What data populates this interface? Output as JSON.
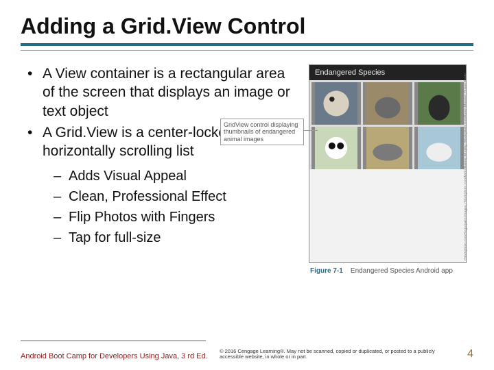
{
  "title": "Adding a Grid.View Control",
  "bullets": {
    "b1": "A View container is a rectangular area of the screen that displays an  image or text object",
    "b2": "A Grid.View is a center-locked horizontally scrolling list",
    "sub1": "Adds Visual Appeal",
    "sub2": "Clean, Professional Effect",
    "sub3": "Flip Photos with Fingers",
    "sub4": "Tap for full-size"
  },
  "figure": {
    "headerTitle": "Endangered Species",
    "callout": "GridView control displaying thumbnails of endangered animal images",
    "caption_num": "Figure 7-1",
    "caption_text": "Endangered Species Android app",
    "sidecredit": "iStockphoto.com/Sugarpalm Images; iStockphoto.com/Micki Manns; Murphy, iStockphoto.com/Karen Massier; Dusan Kostic"
  },
  "footer": {
    "left": "Android Boot Camp for Developers Using Java, 3 rd Ed.",
    "mid": "© 2016 Cengage Learning®. May not be scanned, copied or duplicated, or posted to a publicly accessible website, in whole or in part.",
    "page": "4"
  }
}
